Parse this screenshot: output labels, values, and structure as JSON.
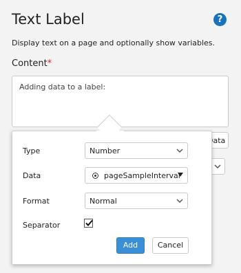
{
  "header": {
    "title": "Text Label",
    "help_icon": "?",
    "description": "Display text on a page and optionally show variables."
  },
  "content": {
    "label": "Content",
    "required_mark": "*",
    "value": "Adding data to a label:",
    "insert_button_label": "Data"
  },
  "popover": {
    "type": {
      "label": "Type",
      "value": "Number"
    },
    "data": {
      "label": "Data",
      "value": "pageSampleInterval",
      "icon": "target-icon"
    },
    "format": {
      "label": "Format",
      "value": "Normal"
    },
    "separator": {
      "label": "Separator",
      "checked": true
    },
    "add_label": "Add",
    "cancel_label": "Cancel"
  },
  "colors": {
    "accent": "#3a8fd6",
    "help": "#1a73b8",
    "required": "#d9232e"
  }
}
